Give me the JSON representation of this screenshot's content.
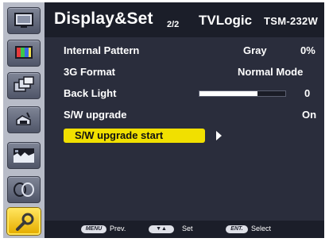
{
  "sidebar": {
    "items": [
      {
        "icon": "monitor-icon"
      },
      {
        "icon": "color-palette-icon"
      },
      {
        "icon": "multi-window-icon"
      },
      {
        "icon": "audio-speaker-icon"
      },
      {
        "icon": "image-adjust-icon"
      },
      {
        "icon": "waveform-icon"
      },
      {
        "icon": "tools-icon",
        "active": true
      }
    ]
  },
  "header": {
    "title": "Display&Set",
    "page": "2/2",
    "brand": "TVLogic",
    "model": "TSM-232W"
  },
  "menu": {
    "internal_pattern": {
      "label": "Internal Pattern",
      "value": "Gray",
      "value2": "0%"
    },
    "g3_format": {
      "label": "3G Format",
      "value": "Normal Mode"
    },
    "back_light": {
      "label": "Back Light",
      "value": "0",
      "level_fraction": 0.68
    },
    "sw_upgrade": {
      "label": "S/W upgrade",
      "value": "On"
    },
    "sw_upgrade_start": {
      "label": "S/W upgrade start"
    }
  },
  "footer": {
    "menu_key": "MENU",
    "menu_text": "Prev.",
    "nav_key": "▼▲",
    "nav_text": "Set",
    "ent_key": "ENT.",
    "ent_text": "Select"
  },
  "colors": {
    "highlight": "#f1e000",
    "panel": "#2a2d3c",
    "header": "#1b1e29"
  }
}
